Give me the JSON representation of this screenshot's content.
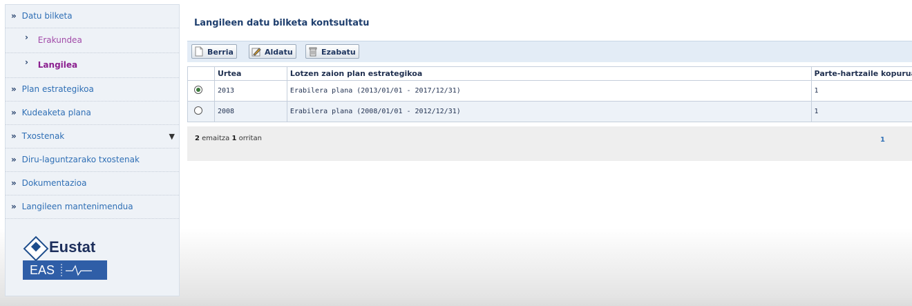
{
  "sidebar": {
    "items": [
      {
        "label": "Datu bilketa"
      },
      {
        "label": "Erakundea"
      },
      {
        "label": "Langilea"
      },
      {
        "label": "Plan estrategikoa"
      },
      {
        "label": "Kudeaketa plana"
      },
      {
        "label": "Txostenak"
      },
      {
        "label": "Diru-laguntzarako txostenak"
      },
      {
        "label": "Dokumentazioa"
      },
      {
        "label": "Langileen mantenimendua"
      }
    ],
    "logo": {
      "brand": "Eustat",
      "sub": "EAS"
    }
  },
  "main": {
    "title": "Langileen datu bilketa kontsultatu",
    "toolbar": {
      "new_label": "Berria",
      "edit_label": "Aldatu",
      "delete_label": "Ezabatu"
    },
    "table": {
      "headers": [
        "",
        "Urtea",
        "Lotzen zaion plan estrategikoa",
        "Parte-hartzaile kopurua"
      ],
      "rows": [
        {
          "selected": true,
          "year": "2013",
          "plan": "Erabilera plana (2013/01/01 - 2017/12/31)",
          "participants": "1"
        },
        {
          "selected": false,
          "year": "2008",
          "plan": "Erabilera plana (2008/01/01 - 2012/12/31)",
          "participants": "1"
        }
      ]
    },
    "pagination": {
      "results": "2",
      "results_text": "emaitza",
      "pages": "1",
      "pages_text": "orritan",
      "current_page": "1"
    }
  }
}
